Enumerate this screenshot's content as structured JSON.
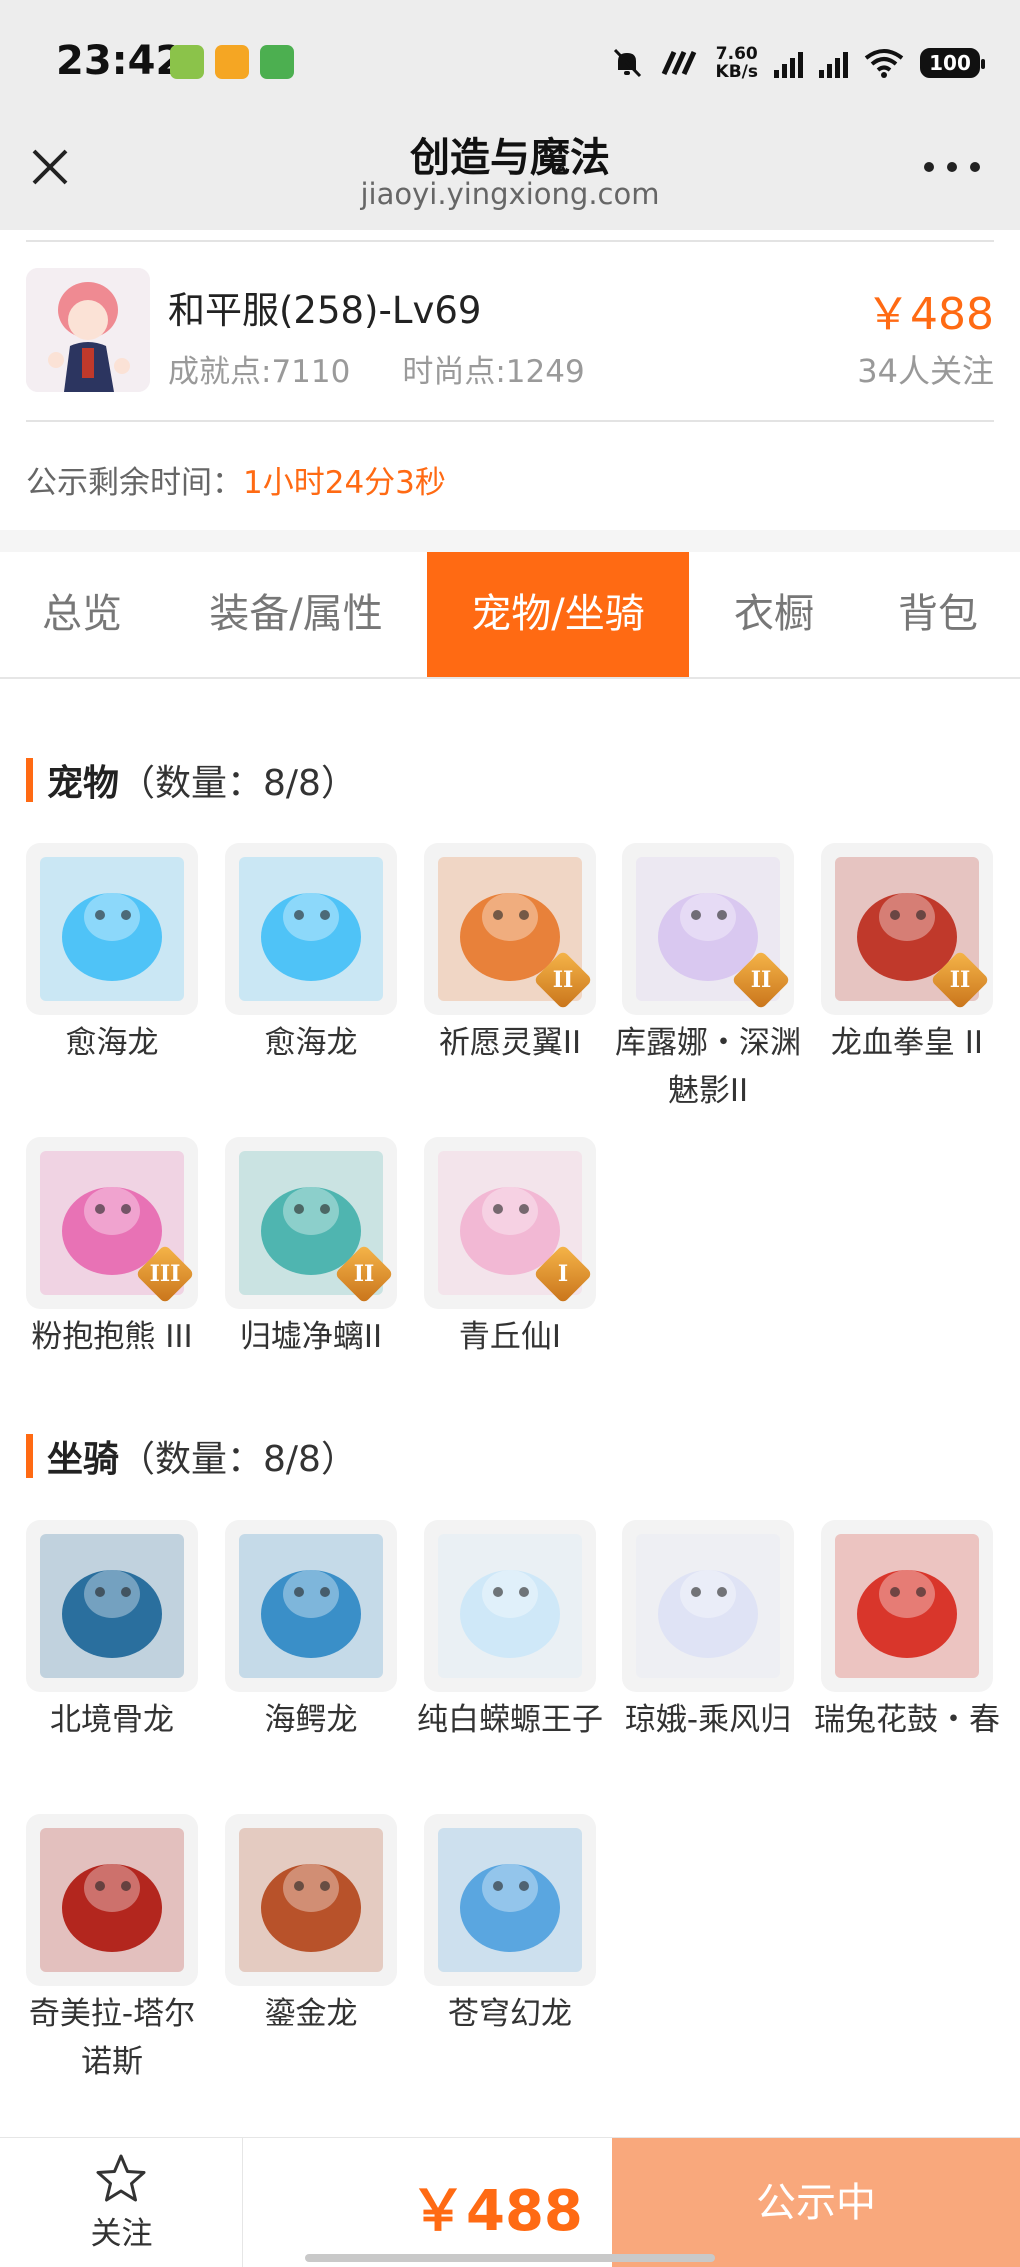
{
  "status_bar": {
    "time": "23:42",
    "net_speed_value": "7.60",
    "net_speed_unit": "KB/s",
    "signal_1": "5G",
    "signal_2": "5G",
    "battery": "100",
    "colors": {
      "app1": "#8bc34a",
      "app2": "#f5a623",
      "app3": "#4caf50"
    }
  },
  "nav": {
    "title": "创造与魔法",
    "subtitle": "jiaoyi.yingxiong.com",
    "close_icon": "close-icon",
    "more_icon": "more-icon"
  },
  "product": {
    "name": "和平服(258)-Lv69",
    "achievement": "成就点:7110",
    "fashion": "时尚点:1249",
    "price": "￥488",
    "followers": "34人关注",
    "notice_label": "公示剩余时间：",
    "notice_time": "1小时24分3秒"
  },
  "tabs": [
    "总览",
    "装备/属性",
    "宠物/坐骑",
    "衣橱",
    "背包"
  ],
  "active_tab": "宠物/坐骑",
  "pets": {
    "title": "宠物",
    "count": "（数量：8/8）",
    "items": [
      {
        "name": "愈海龙",
        "tier": "",
        "color": "#4fc3f7"
      },
      {
        "name": "愈海龙",
        "tier": "",
        "color": "#4fc3f7"
      },
      {
        "name": "祈愿灵翼II",
        "tier": "II",
        "color": "#e8813a"
      },
      {
        "name": "库露娜・深渊魅影II",
        "tier": "II",
        "color": "#d9c8f0"
      },
      {
        "name": "龙血拳皇 II",
        "tier": "II",
        "color": "#c0392b"
      },
      {
        "name": "粉抱抱熊 III",
        "tier": "III",
        "color": "#e872b5"
      },
      {
        "name": "归墟净螭II",
        "tier": "II",
        "color": "#4fb5b0"
      },
      {
        "name": "青丘仙I",
        "tier": "I",
        "color": "#f2b8d4"
      }
    ]
  },
  "mounts": {
    "title": "坐骑",
    "count": "（数量：8/8）",
    "items": [
      {
        "name": "北境骨龙",
        "color": "#2a6f9e"
      },
      {
        "name": "海鳄龙",
        "color": "#3a8fc8"
      },
      {
        "name": "纯白蝾螈王子",
        "color": "#cfe8f8"
      },
      {
        "name": "琼娥-乘风归",
        "color": "#dfe3f5"
      },
      {
        "name": "瑞兔花鼓・春",
        "color": "#d9362b"
      },
      {
        "name": "奇美拉-塔尔诺斯",
        "color": "#b3261e"
      },
      {
        "name": "鎏金龙",
        "color": "#b8522a"
      },
      {
        "name": "苍穹幻龙",
        "color": "#5aa6e0"
      }
    ]
  },
  "bottom_bar": {
    "follow_label": "关注",
    "price": "￥488",
    "status_label": "公示中",
    "star_icon": "star-icon"
  }
}
